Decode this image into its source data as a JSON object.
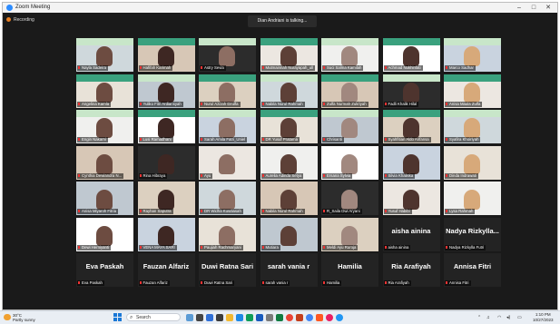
{
  "window": {
    "title": "Zoom Meeting"
  },
  "recording_label": "Recording",
  "talking_indicator": "Dian Andriani is talking...",
  "participants": [
    {
      "name": "Nayla Sadeira",
      "kind": "video"
    },
    {
      "name": "Hafifah Karimah",
      "kind": "video"
    },
    {
      "name": "Astry Sevia",
      "kind": "video"
    },
    {
      "name": "Mutmainnah Nurayapah_ull",
      "kind": "video"
    },
    {
      "name": "Suci Salma Kamilah",
      "kind": "video"
    },
    {
      "name": "Achmad Nukhinfati",
      "kind": "video"
    },
    {
      "name": "Marco Sadhar",
      "kind": "video"
    },
    {
      "name": "Angelina Kamla",
      "kind": "video"
    },
    {
      "name": "Yuliko Fitri Ardiansyah",
      "kind": "video"
    },
    {
      "name": "Nurul Azizah Dzulfa",
      "kind": "video"
    },
    {
      "name": "Nabila Nurul Rahmah",
      "kind": "video"
    },
    {
      "name": "Zulfa Nurmah Zukriyah",
      "kind": "video"
    },
    {
      "name": "Fadli Khalik Hilal",
      "kind": "video"
    },
    {
      "name": "Anisa Maula Zulfa",
      "kind": "video"
    },
    {
      "name": "Engin Nakami",
      "kind": "video"
    },
    {
      "name": "Lusi Ramadhani",
      "kind": "video"
    },
    {
      "name": "Sarah Amila Fatri_Uniel",
      "kind": "video"
    },
    {
      "name": "DR Yusuf Pratama",
      "kind": "video"
    },
    {
      "name": "Chrisanti",
      "kind": "video"
    },
    {
      "name": "Syahfitian Aldo Anfansa",
      "kind": "video"
    },
    {
      "name": "Syafira Khoiriyah",
      "kind": "video"
    },
    {
      "name": "Cynthia Dewiandra N...",
      "kind": "video"
    },
    {
      "name": "Rina Hibraya",
      "kind": "video"
    },
    {
      "name": "Ayu",
      "kind": "video"
    },
    {
      "name": "Aurelia Adinda Setya",
      "kind": "video"
    },
    {
      "name": "Ersana Sylvia",
      "kind": "video"
    },
    {
      "name": "Silvia Khaliska",
      "kind": "video"
    },
    {
      "name": "Dinda Indrawati",
      "kind": "video"
    },
    {
      "name": "Anisa Miyaroh Fitria",
      "kind": "video"
    },
    {
      "name": "Rayhan Saputra",
      "kind": "video"
    },
    {
      "name": "DR Widha Kusdiasah",
      "kind": "video"
    },
    {
      "name": "Nabila Nurul Rahmah",
      "kind": "video"
    },
    {
      "name": "R_Saila Dwi Aryani",
      "kind": "video"
    },
    {
      "name": "Yusuf Habibi",
      "kind": "video"
    },
    {
      "name": "Lysa Rahmah",
      "kind": "video"
    },
    {
      "name": "Dewi Herniyanti",
      "kind": "video"
    },
    {
      "name": "VENA MAYA SARI",
      "kind": "video"
    },
    {
      "name": "Paujiah Rachmaryani",
      "kind": "video"
    },
    {
      "name": "Mutiara",
      "kind": "video"
    },
    {
      "name": "Meldi Ayu Ruroja",
      "kind": "video"
    },
    {
      "name": "aisha ainina",
      "kind": "text"
    },
    {
      "name": "Nadya Rizkylla Futri",
      "big": "Nadya Rizkylla...",
      "kind": "text"
    },
    {
      "name": "Eva Paskah",
      "kind": "text"
    },
    {
      "name": "Fauzan Alfariz",
      "kind": "text"
    },
    {
      "name": "Duwi Ratna Sari",
      "kind": "text"
    },
    {
      "name": "sarah vania r",
      "kind": "text"
    },
    {
      "name": "Hamilia",
      "kind": "text"
    },
    {
      "name": "Ria Arafiyah",
      "kind": "text"
    },
    {
      "name": "Annisa Fitri",
      "kind": "text"
    }
  ],
  "taskbar": {
    "weather_temp": "30°C",
    "weather_desc": "Partly sunny",
    "search_placeholder": "Search",
    "time": "1:10 PM",
    "date": "10/27/2023",
    "colors": {
      "start": "#1b78d6"
    }
  }
}
